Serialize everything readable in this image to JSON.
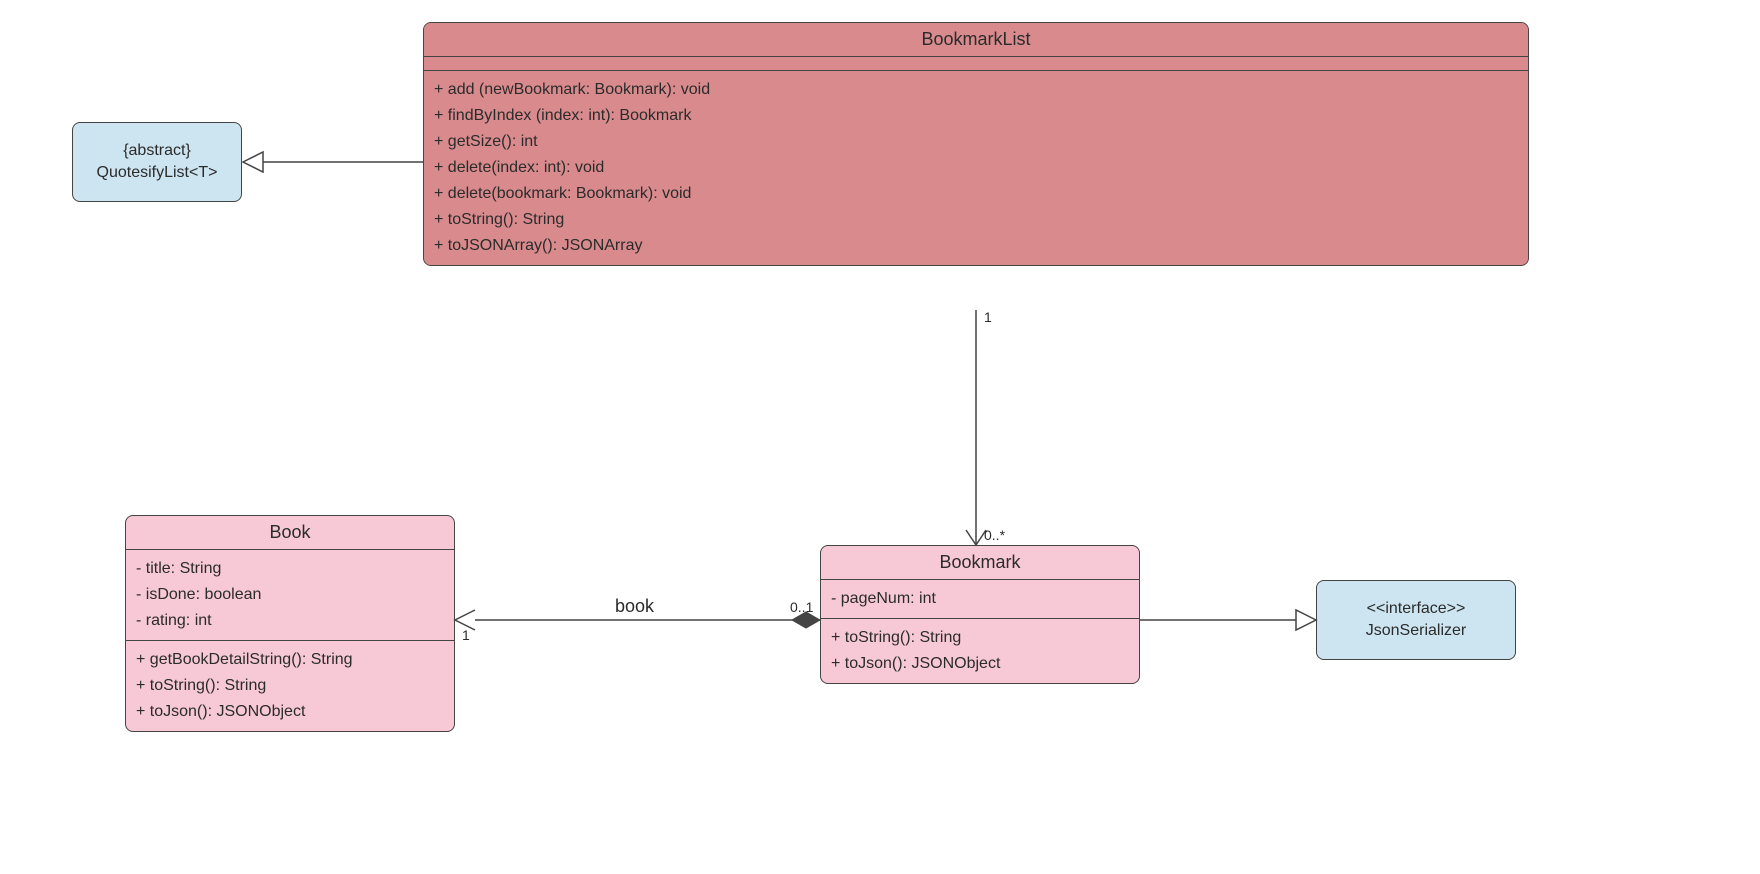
{
  "quotesifylist": {
    "line1": "{abstract}",
    "line2": "QuotesifyList<T>"
  },
  "jsonserializer": {
    "line1": "<<interface>>",
    "line2": "JsonSerializer"
  },
  "bookmarklist": {
    "title": "BookmarkList",
    "ops": [
      "+ add (newBookmark: Bookmark): void",
      "+ findByIndex (index: int): Bookmark",
      "+ getSize(): int",
      "+ delete(index: int): void",
      "+ delete(bookmark: Bookmark): void",
      "+ toString(): String",
      "+ toJSONArray(): JSONArray"
    ]
  },
  "book": {
    "title": "Book",
    "attrs": [
      "- title: String",
      "- isDone: boolean",
      "- rating: int"
    ],
    "ops": [
      "+ getBookDetailString(): String",
      "+ toString(): String",
      "+ toJson(): JSONObject"
    ]
  },
  "bookmark": {
    "title": "Bookmark",
    "attrs": [
      "- pageNum: int"
    ],
    "ops": [
      "+ toString(): String",
      "+ toJson(): JSONObject"
    ]
  },
  "labels": {
    "book_assoc": "book",
    "mult_1_a": "1",
    "mult_1_b": "1",
    "mult_0_star": "0..*",
    "mult_0_1": "0..1"
  }
}
